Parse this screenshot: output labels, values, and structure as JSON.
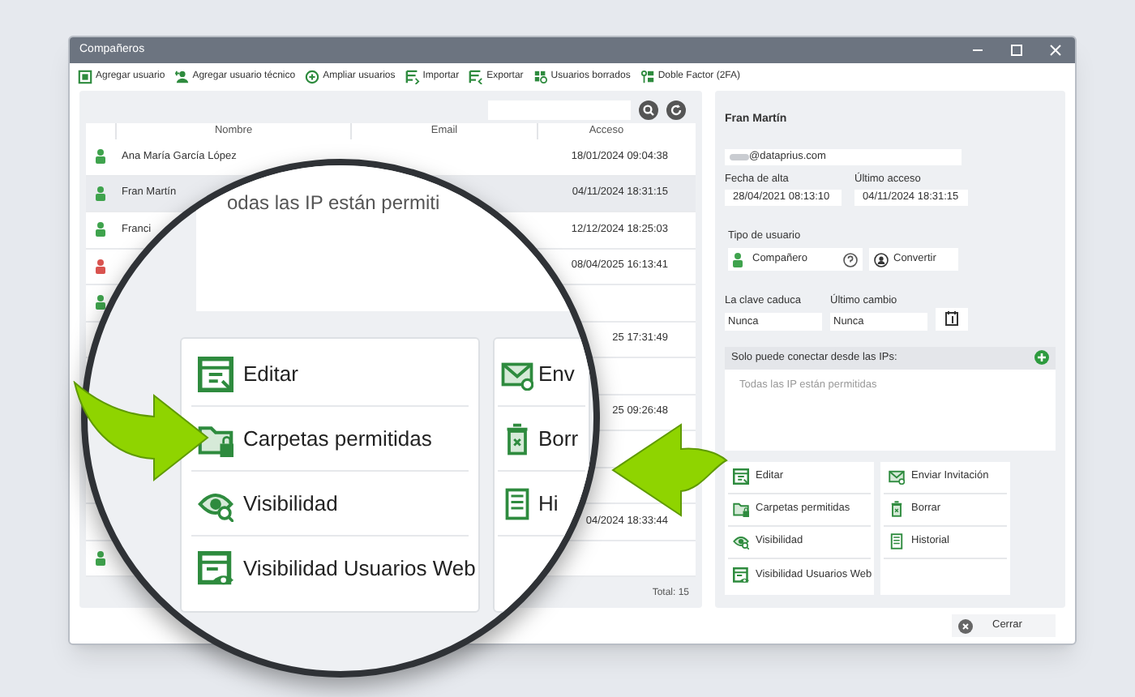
{
  "window": {
    "title": "Compañeros"
  },
  "toolbar": [
    "Agregar usuario",
    "Agregar usuario técnico",
    "Ampliar usuarios",
    "Importar",
    "Exportar",
    "Usuarios borrados",
    "Doble Factor (2FA)"
  ],
  "user_list": {
    "columns": [
      "Nombre",
      "Email",
      "Acceso"
    ],
    "rows": [
      {
        "name": "Ana María García López",
        "access": "18/01/2024 09:04:38",
        "color": "#3fa34d",
        "selected": false
      },
      {
        "name": "Fran Martín",
        "access": "04/11/2024 18:31:15",
        "color": "#3fa34d",
        "selected": true
      },
      {
        "name": "Franci",
        "access": "12/12/2024 18:25:03",
        "color": "#3fa34d",
        "selected": false
      },
      {
        "access": "08/04/2025 16:13:41",
        "color": "#d9534f",
        "selected": false
      },
      {
        "color": "#3fa34d",
        "selected": false
      },
      {
        "access": "25 17:31:49",
        "selected": false
      },
      {
        "selected": false
      },
      {
        "access": "25 09:26:48",
        "selected": false
      },
      {
        "selected": false
      },
      {
        "selected": false
      },
      {
        "access": "04/2024 18:33:44",
        "selected": false
      },
      {
        "color": "#3fa34d",
        "selected": false
      }
    ],
    "total": "Total: 15"
  },
  "details": {
    "name": "Fran Martín",
    "email": "@dataprius.com",
    "created_label": "Fecha de alta",
    "created": "28/04/2021 08:13:10",
    "last_access_label": "Último acceso",
    "last_access": "04/11/2024 18:31:15",
    "user_type_label": "Tipo de usuario",
    "user_type": "Compañero",
    "convert_button": "Convertir",
    "expires_label": "La clave caduca",
    "expires": "Nunca",
    "last_change_label": "Último cambio",
    "last_change": "Nunca",
    "ip_label": "Solo puede conectar desde las IPs:",
    "ip_text": "Todas las IP están permitidas",
    "actions_left": [
      "Editar",
      "Carpetas permitidas",
      "Visibilidad",
      "Visibilidad Usuarios Web"
    ],
    "actions_right": [
      "Enviar Invitación",
      "Borrar",
      "Historial"
    ]
  },
  "magnifier": {
    "ip_text": "odas las IP están permiti",
    "actions_left": [
      "Editar",
      "Carpetas permitidas",
      "Visibilidad",
      "Visibilidad Usuarios Web"
    ],
    "actions_right": [
      "Env",
      "Borr",
      "Hi"
    ]
  },
  "close_button": "Cerrar"
}
